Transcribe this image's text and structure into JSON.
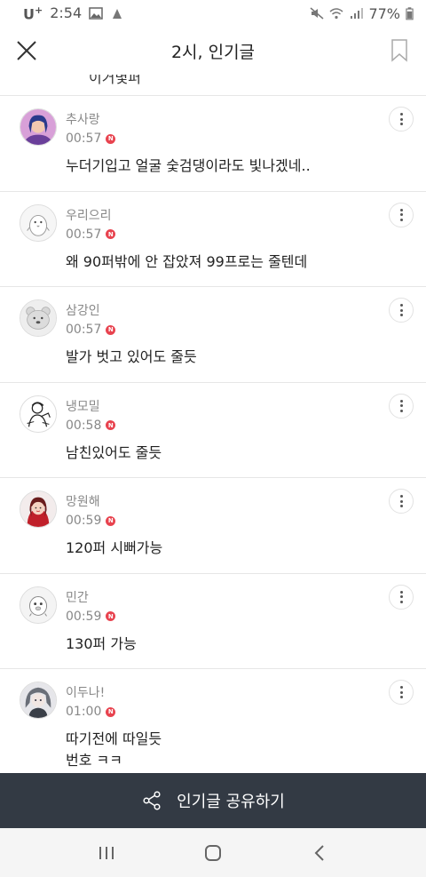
{
  "status_bar": {
    "carrier": "U",
    "carrier_sup": "+",
    "time": "2:54",
    "battery": "77%"
  },
  "header": {
    "title": "2시, 인기글"
  },
  "partial_text": "이거몇퍼",
  "comments": [
    {
      "username": "추사랑",
      "time": "00:57",
      "text": "누더기입고 얼굴 숯검댕이라도 빛나겠네..",
      "avatar": "photo-girl-avatar"
    },
    {
      "username": "우리으리",
      "time": "00:57",
      "text": "왜 90퍼밖에 안 잡았져 99프로는 줄텐데",
      "avatar": "penguin-avatar"
    },
    {
      "username": "삼강인",
      "time": "00:57",
      "text": "발가 벗고 있어도 줄듯",
      "avatar": "bear-avatar"
    },
    {
      "username": "냉모밀",
      "time": "00:58",
      "text": "남친있어도 줄듯",
      "avatar": "sketch-avatar"
    },
    {
      "username": "망원해",
      "time": "00:59",
      "text": "120퍼 시뻐가능",
      "avatar": "red-hood-avatar"
    },
    {
      "username": "민간",
      "time": "00:59",
      "text": "130퍼 가능",
      "avatar": "chick-avatar"
    },
    {
      "username": "이두나!",
      "time": "01:00",
      "text": "따기전에 따일듯\n번호 ㅋㅋ",
      "avatar": "anime-avatar"
    }
  ],
  "badge_letter": "N",
  "share_bar": {
    "label": "인기글 공유하기"
  },
  "colors": {
    "badge": "#e8434f",
    "share_bar": "#333a44",
    "divider": "#e6e6e6"
  }
}
